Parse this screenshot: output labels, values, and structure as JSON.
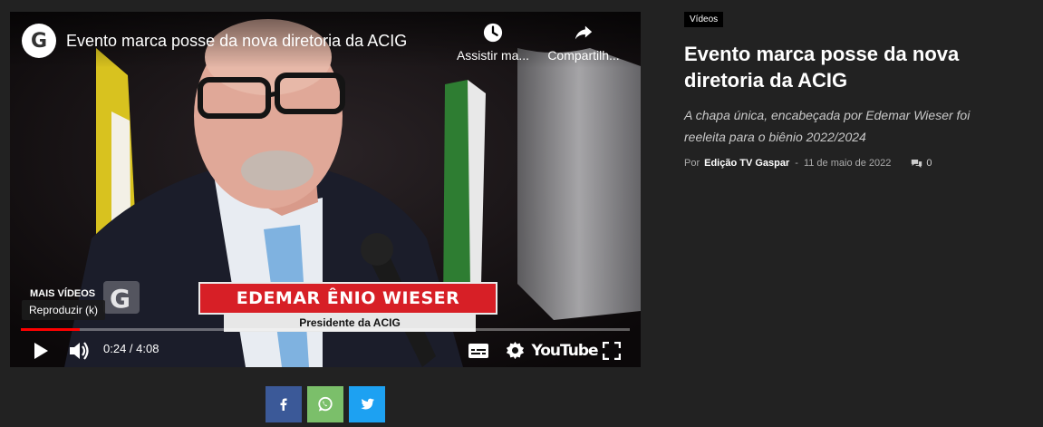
{
  "video": {
    "channel_logo_text": "G",
    "title": "Evento marca posse da nova diretoria da ACIG",
    "watch_later_label": "Assistir ma...",
    "share_label": "Compartilh...",
    "more_videos_label": "MAIS VÍDEOS",
    "tooltip": "Reproduzir (k)",
    "lower_third_name": "EDEMAR ÊNIO WIESER",
    "lower_third_role": "Presidente da ACIG",
    "current_time": "0:24 / 4:08",
    "progress_fraction": 0.097,
    "youtube_label": "YouTube"
  },
  "share": {
    "facebook_color": "#3b5998",
    "whatsapp_color": "#7bbf6a",
    "twitter_color": "#1da1f2"
  },
  "article": {
    "category": "Vídeos",
    "headline": "Evento marca posse da nova diretoria da ACIG",
    "subheadline": "A chapa única, encabeçada por Edemar Wieser foi reeleita para o biênio 2022/2024",
    "by_label": "Por",
    "author": "Edição TV Gaspar",
    "separator": "-",
    "date": "11 de maio de 2022",
    "comments_count": "0"
  }
}
